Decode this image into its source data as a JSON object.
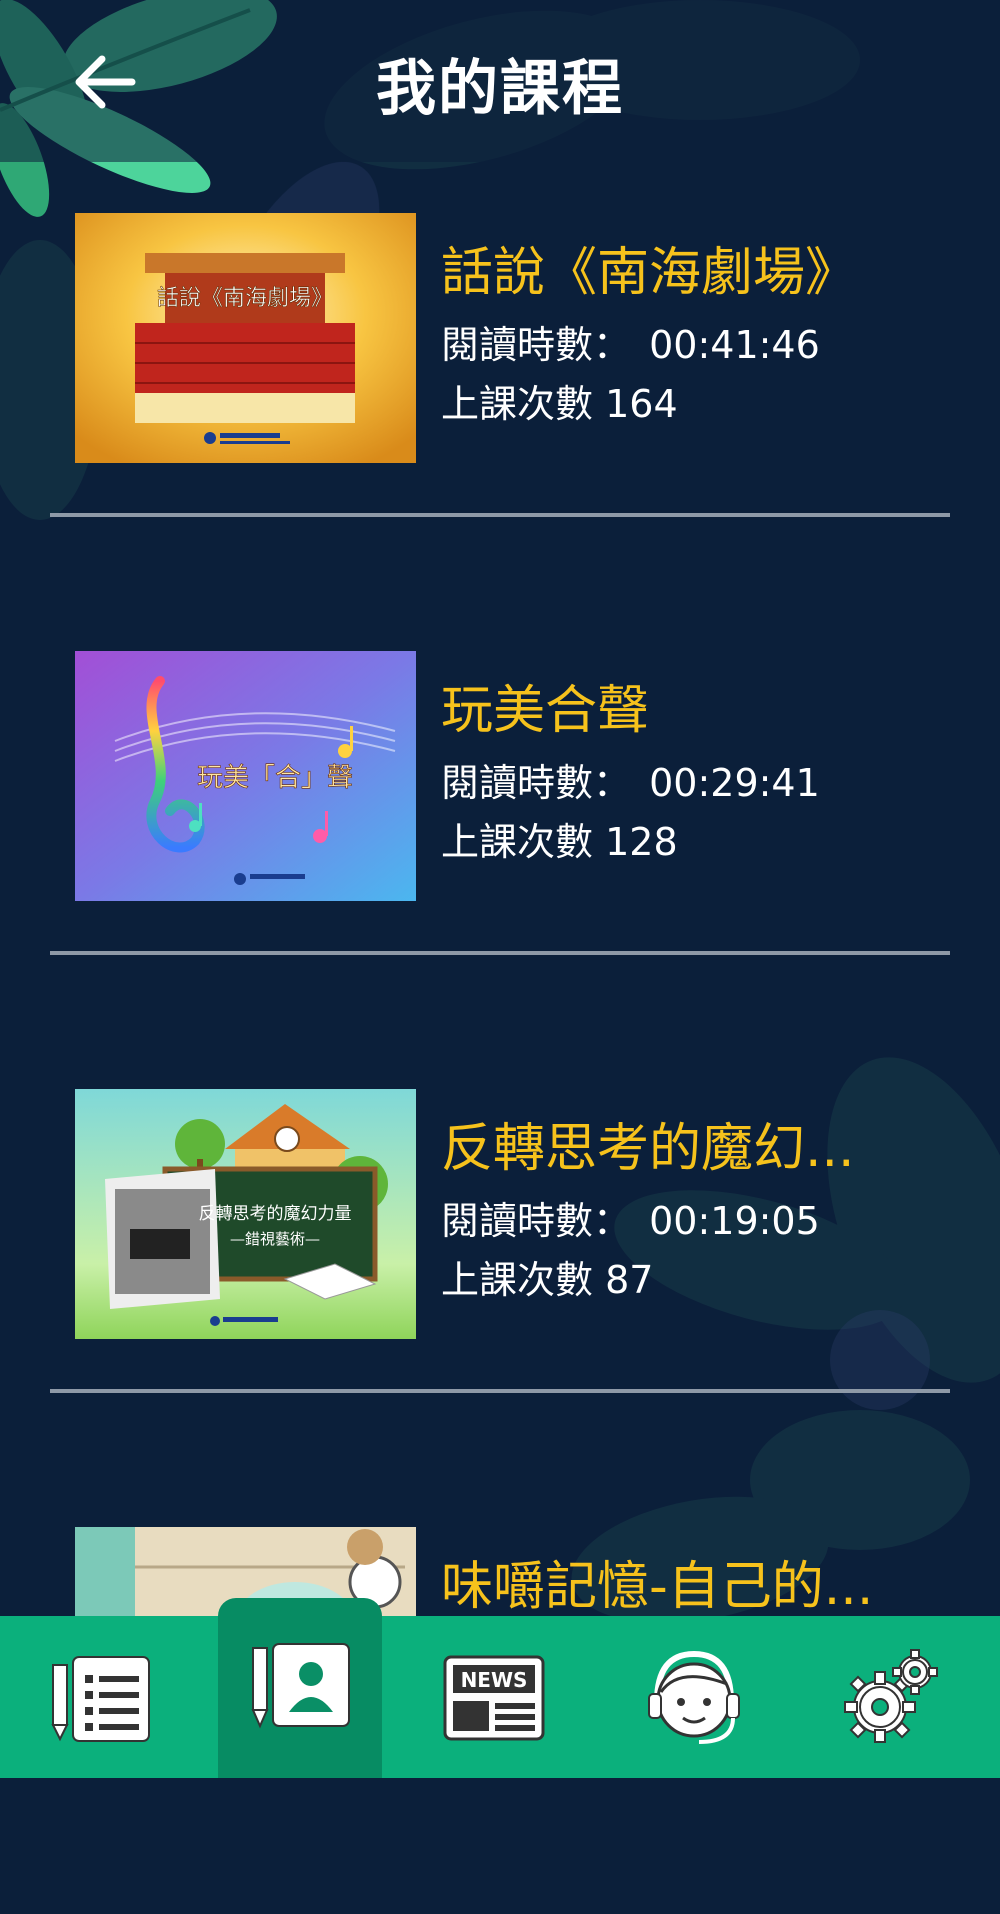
{
  "header": {
    "title": "我的課程",
    "back_icon": "arrow-left-icon"
  },
  "courses": [
    {
      "title": "話說《南海劇場》",
      "read_time_label": "閱讀時數：",
      "read_time": "00:41:46",
      "lessons_label": "上課次數",
      "lessons": "164",
      "thumb_caption": "話說《南海劇場》"
    },
    {
      "title": "玩美合聲",
      "read_time_label": "閱讀時數：",
      "read_time": "00:29:41",
      "lessons_label": "上課次數",
      "lessons": "128",
      "thumb_caption": "玩美「合」聲"
    },
    {
      "title": "反轉思考的魔幻...",
      "read_time_label": "閱讀時數：",
      "read_time": "00:19:05",
      "lessons_label": "上課次數",
      "lessons": "87",
      "thumb_caption": "反轉思考的魔幻力量",
      "thumb_subcaption": "—錯視藝術—"
    },
    {
      "title": "味嚼記憶-自己的..."
    }
  ],
  "tabbar": {
    "tabs": [
      {
        "icon": "course-list-icon",
        "active": false
      },
      {
        "icon": "my-courses-icon",
        "active": true
      },
      {
        "icon": "news-icon",
        "active": false,
        "label": "NEWS"
      },
      {
        "icon": "customer-service-icon",
        "active": false
      },
      {
        "icon": "settings-gears-icon",
        "active": false
      }
    ]
  },
  "colors": {
    "background": "#0b1f3a",
    "title_accent": "#f6c21c",
    "tabbar": "#0bb07c",
    "tab_active": "#078c63"
  }
}
